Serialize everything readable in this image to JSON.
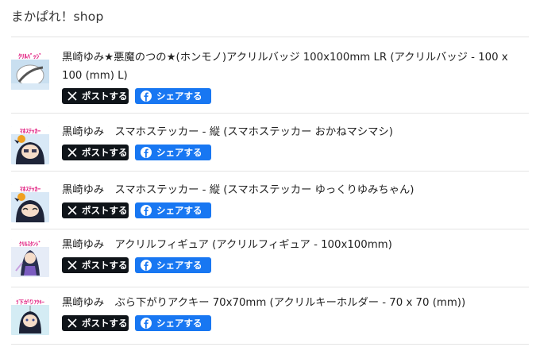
{
  "shop": {
    "title": "まかぱれ！shop"
  },
  "share": {
    "x_label": "ポストする",
    "fb_label": "シェアする",
    "x_color": "#0f1419",
    "fb_color": "#1877f2"
  },
  "items": [
    {
      "title": "黒崎ゆみ★悪魔のつの★(ホンモノ)アクリルバッジ 100x100mm LR (アクリルバッジ - 100 x 100 (mm) L)",
      "thumb_text": "ｸﾘﾙﾊﾞｯｼﾞ",
      "thumb_color": "#f2c4c4"
    },
    {
      "title": "黒崎ゆみ　スマホステッカー - 縦 (スマホステッカー おかねマシマシ)",
      "thumb_text": "ﾏﾎｽﾃｯｶｰ",
      "thumb_color": "#cfe3f4"
    },
    {
      "title": "黒崎ゆみ　スマホステッカー - 縦 (スマホステッカー ゆっくりゆみちゃん)",
      "thumb_text": "ﾏﾎｽﾃｯｶｰ",
      "thumb_color": "#cfe3f4"
    },
    {
      "title": "黒崎ゆみ　アクリルフィギュア (アクリルフィギュア - 100x100mm)",
      "thumb_text": "ｸﾘﾙｽﾀﾝﾄﾞ",
      "thumb_color": "#dfe6f5"
    },
    {
      "title": "黒崎ゆみ　ぶら下がりアクキー 70x70mm (アクリルキーホルダー - 70 x 70 (mm))",
      "thumb_text": "ﾗ下がりｱｸｷｰ",
      "thumb_color": "#cfe9f2"
    }
  ]
}
